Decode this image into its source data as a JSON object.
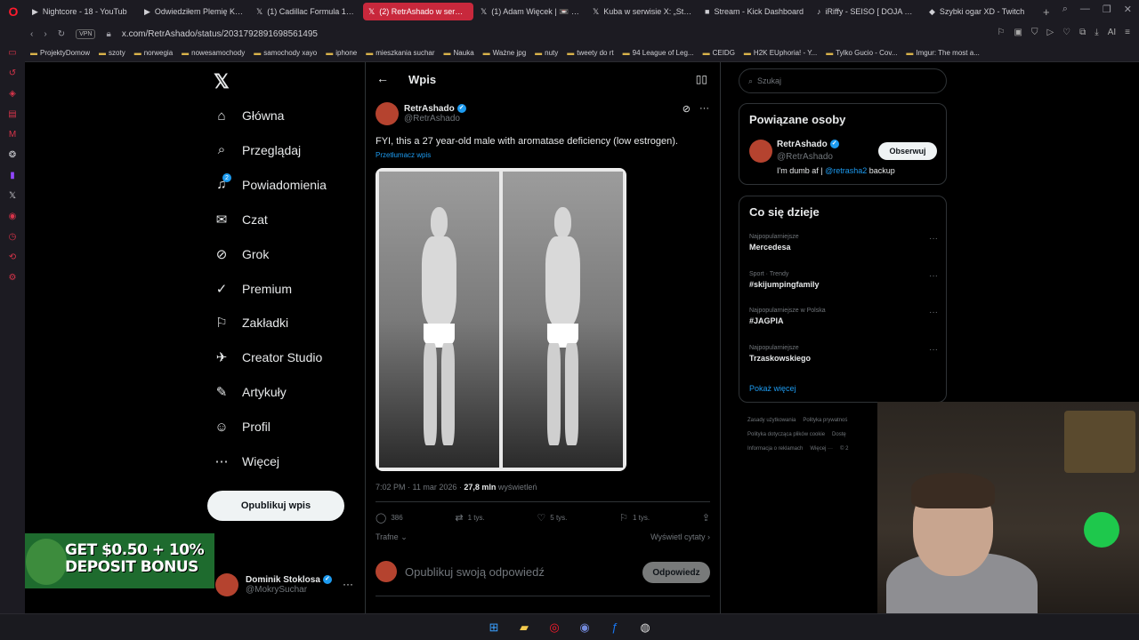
{
  "browser": {
    "tabs": [
      {
        "icon": "▶",
        "title": "Nightcore - 18 - YouTub",
        "active": false
      },
      {
        "icon": "▶",
        "title": "Odwiedziłem Plemię Kanib",
        "active": false
      },
      {
        "icon": "𝕏",
        "title": "(1) Cadillac Formula 1 Tea",
        "active": false
      },
      {
        "icon": "𝕏",
        "title": "(2) RetrAshado w serwisie",
        "active": true
      },
      {
        "icon": "𝕏",
        "title": "(1) Adam Więcek | 📼 Łod",
        "active": false
      },
      {
        "icon": "𝕏",
        "title": "Kuba w serwisie X: „Strea",
        "active": false
      },
      {
        "icon": "■",
        "title": "Stream - Kick Dashboard",
        "active": false
      },
      {
        "icon": "♪",
        "title": "iRiffy - SEISO [ DOJA CAT",
        "active": false
      },
      {
        "icon": "◆",
        "title": "Szybki ogar XD - Twitch",
        "active": false
      }
    ],
    "url": "x.com/RetrAshado/status/2031792891698561495",
    "vpn_label": "VPN",
    "bookmarks": [
      "ProjektyDomow",
      "szoty",
      "norwegia",
      "nowesamochody",
      "samochody xayo",
      "iphone",
      "mieszkania suchar",
      "Nauka",
      "Ważne jpg",
      "nuty",
      "tweety do rt",
      "94 League of Leg...",
      "CEIDG",
      "H2K EUphoria! - Y...",
      "Tylko Gucio - Cov...",
      "Imgur: The most a..."
    ]
  },
  "nav": {
    "items": [
      {
        "label": "Główna",
        "icon": "home-icon",
        "glyph": "⌂"
      },
      {
        "label": "Przeglądaj",
        "icon": "search-icon",
        "glyph": "⌕"
      },
      {
        "label": "Powiadomienia",
        "icon": "bell-icon",
        "glyph": "♫"
      },
      {
        "label": "Czat",
        "icon": "mail-icon",
        "glyph": "✉"
      },
      {
        "label": "Grok",
        "icon": "grok-icon",
        "glyph": "⊘"
      },
      {
        "label": "Premium",
        "icon": "premium-icon",
        "glyph": "✓"
      },
      {
        "label": "Zakładki",
        "icon": "bookmark-icon",
        "glyph": "⚐"
      },
      {
        "label": "Creator Studio",
        "icon": "rocket-icon",
        "glyph": "✈"
      },
      {
        "label": "Artykuły",
        "icon": "article-icon",
        "glyph": "✎"
      },
      {
        "label": "Profil",
        "icon": "profile-icon",
        "glyph": "☺"
      },
      {
        "label": "Więcej",
        "icon": "more-icon",
        "glyph": "⋯"
      }
    ],
    "notification_count": "2",
    "post_button": "Opublikuj wpis",
    "account": {
      "name": "Dominik Stoklosa",
      "handle": "@MokrySuchar"
    }
  },
  "promo": {
    "text_line1": "GET $0.50 + 10%",
    "text_line2": "DEPOSIT BONUS"
  },
  "post": {
    "header_title": "Wpis",
    "author_name": "RetrAshado",
    "author_handle": "@RetrAshado",
    "text": "FYI, this a 27 year-old male with aromatase deficiency (low estrogen).",
    "translate": "Przetłumacz wpis",
    "time": "7:02 PM · 11 mar 2026 · ",
    "views_count": "27,8 mln",
    "views_label": " wyświetleń",
    "replies": "386",
    "reposts": "1 tys.",
    "likes": "5 tys.",
    "bookmarks": "1 tys.",
    "sort_label": "Trafne",
    "quotes_label": "Wyświetl cytaty",
    "reply_placeholder": "Opublikuj swoją odpowiedź",
    "reply_button": "Odpowiedz"
  },
  "right": {
    "search_placeholder": "Szukaj",
    "related_title": "Powiązane osoby",
    "related_user": {
      "name": "RetrAshado",
      "handle": "@RetrAshado",
      "bio_prefix": "I'm dumb af | ",
      "bio_link": "@retrasha2",
      "bio_suffix": " backup",
      "follow": "Obserwuj"
    },
    "trends_title": "Co się dzieje",
    "trends": [
      {
        "context": "Najpopularniejsze",
        "title": "Mercedesa"
      },
      {
        "context": "Sport · Trendy",
        "title": "#skijumpingfamily"
      },
      {
        "context": "Najpopularniejsze w Polska",
        "title": "#JAGPIA"
      },
      {
        "context": "Najpopularniejsze",
        "title": "Trzaskowskiego"
      }
    ],
    "show_more": "Pokaż więcej",
    "footer": [
      "Zasady użytkowania",
      "Polityka prywatnoś",
      "Polityka dotycząca plików cookie",
      "Dostę",
      "Informacja o reklamach",
      "Więcej ···",
      "© 2"
    ]
  },
  "colors": {
    "accent": "#1d9bf0",
    "active_tab": "#c8283c",
    "background": "#000000"
  }
}
